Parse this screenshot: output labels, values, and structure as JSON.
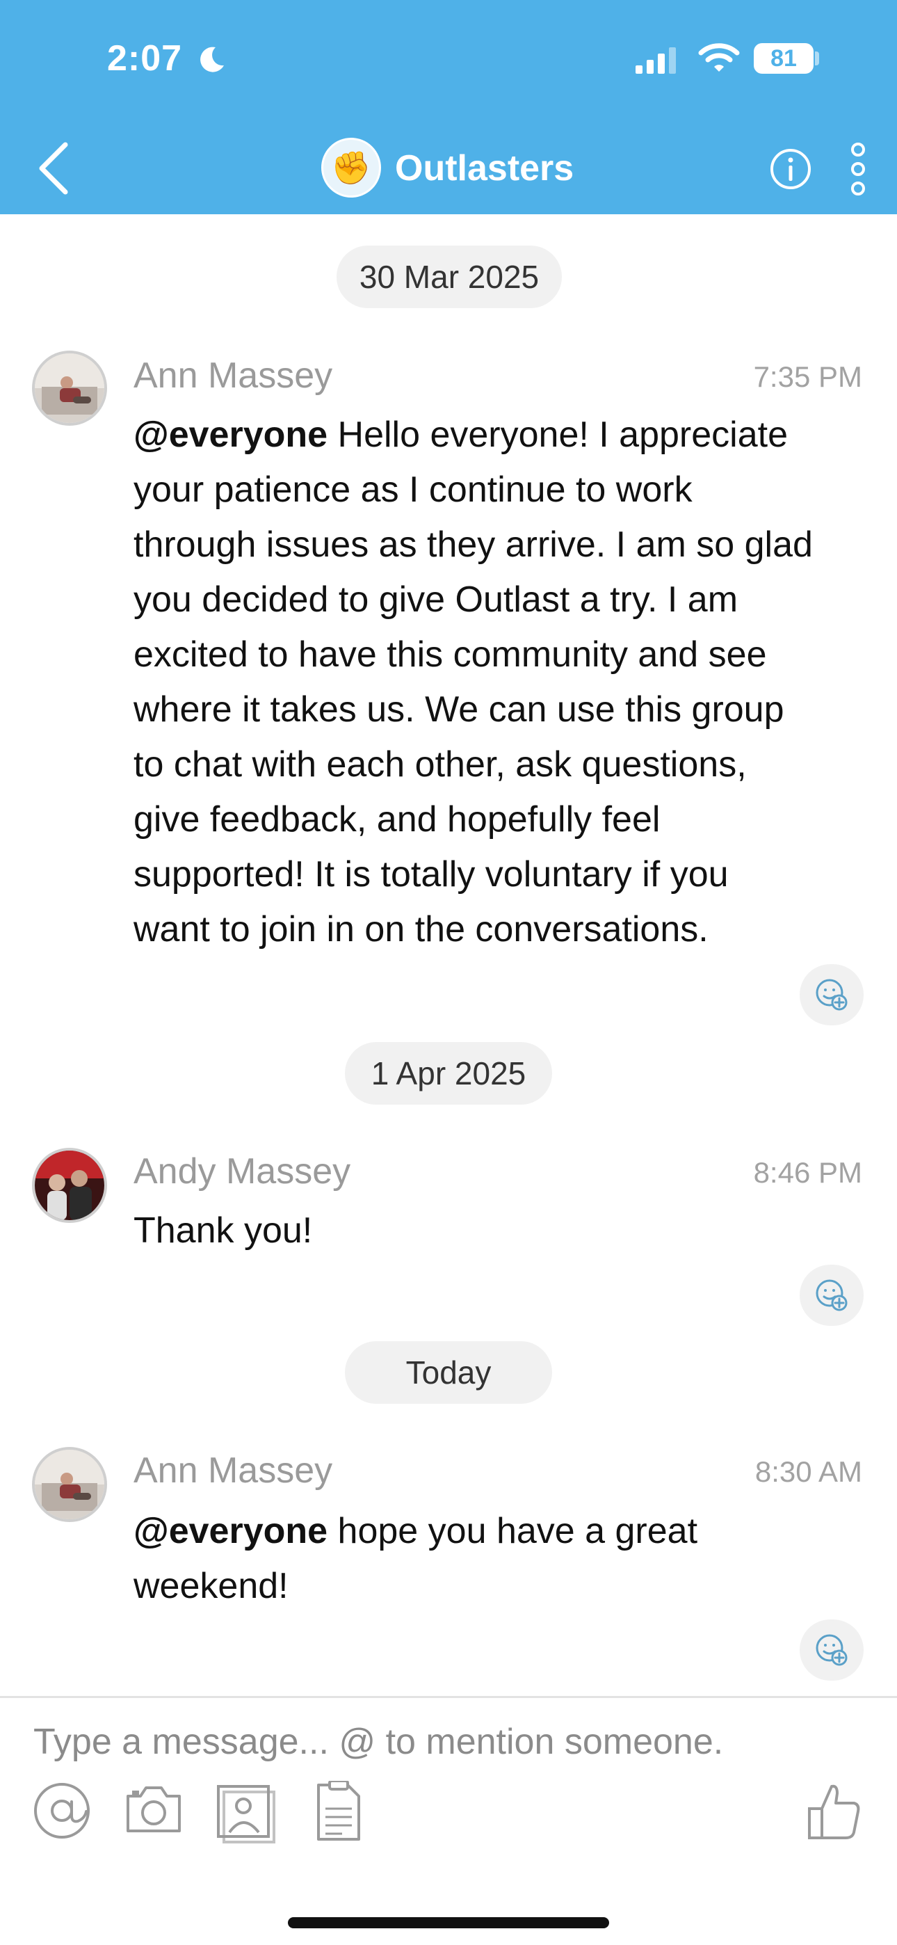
{
  "status_bar": {
    "time": "2:07",
    "battery": "81"
  },
  "header": {
    "title": "Outlasters",
    "group_icon": "✊"
  },
  "composer": {
    "placeholder": "Type a message... @ to mention someone."
  },
  "conversation": {
    "date_1": "30 Mar 2025",
    "date_2": "1 Apr 2025",
    "date_3": "Today",
    "messages": [
      {
        "sender": "Ann Massey",
        "time": "7:35 PM",
        "mention": "@everyone",
        "lines": [
          " Hello everyone!  I appreciate",
          "your patience as I continue to work",
          "through issues as they arrive.  I am so glad",
          "you decided to give Outlast a try.  I am",
          "excited to have this community and see",
          "where it takes us.  We can use this group",
          "to chat with each other, ask questions,",
          "give feedback, and hopefully feel",
          "supported!  It is totally voluntary if you",
          "want to join in on the conversations."
        ]
      },
      {
        "sender": "Andy Massey",
        "time": "8:46 PM",
        "text": "Thank you!"
      },
      {
        "sender": "Ann Massey",
        "time": "8:30 AM",
        "mention": "@everyone",
        "lines": [
          " hope you have a great",
          "weekend!"
        ]
      }
    ]
  },
  "icons": {
    "back": "chevron-left-icon",
    "info": "info-icon",
    "more": "more-vertical-icon",
    "react": "add-reaction-icon",
    "mention": "at-sign-icon",
    "camera": "camera-icon",
    "photo": "photo-library-icon",
    "document": "document-icon",
    "like": "thumbs-up-icon"
  },
  "colors": {
    "header": "#4fb1e8",
    "pill": "#f1f1f1",
    "sender": "#9a9a9a"
  }
}
